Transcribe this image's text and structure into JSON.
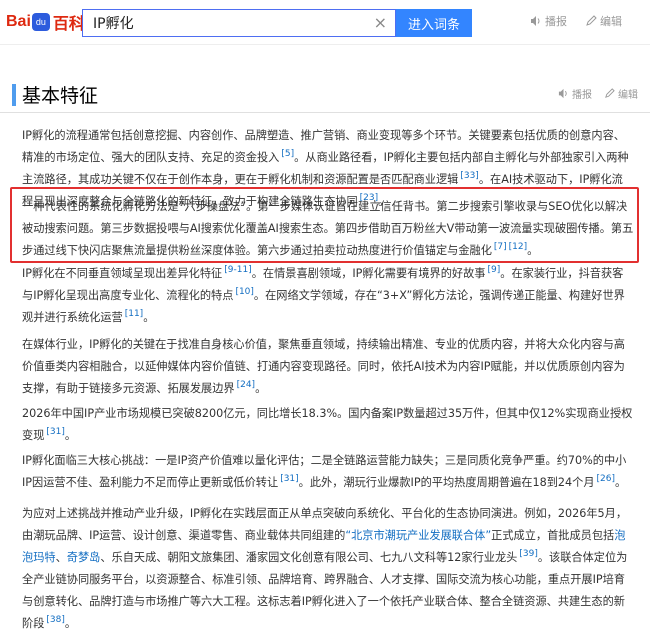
{
  "header": {
    "logo_bai": "Bai",
    "logo_du": "du",
    "logo_baike": "百科",
    "search_value": "IP孵化",
    "search_placeholder": "",
    "clear_icon": "×",
    "enter_button": "进入词条",
    "play_label": "播报",
    "edit_label": "编辑"
  },
  "section": {
    "title": "基本特征",
    "play_label": "播报",
    "edit_label": "编辑"
  },
  "paragraphs": [
    {
      "segments": [
        {
          "t": "IP孵化的流程通常包括创意挖掘、内容创作、品牌塑造、推广营销、商业变现等多个环节。关键要素包括优质的创意内容、精准的市场定位、强大的团队支持、充足的资金投入"
        },
        {
          "r": "[5]"
        },
        {
          "t": "。从商业路径看，IP孵化主要包括内部自主孵化与外部独家引入两种主流路径，其成功关键不仅在于创作本身，更在于孵化机制和资源配置是否匹配商业逻辑"
        },
        {
          "r": "[33]"
        },
        {
          "t": "。在AI技术驱动下，IP孵化流程呈现出深度整合与全链路化的新特征，致力于构建全链路生态协同"
        },
        {
          "r": "[23]"
        },
        {
          "t": "。"
        }
      ]
    },
    {
      "segments": [
        {
          "t": "一种代表性的系统化孵化方法是“六步操盘法”。第一步媒体认证旨在建立信任背书。第二步搜索引擎收录与SEO优化以解决被动搜索问题。第三步数据投喂与AI搜索优化覆盖AI搜索生态。第四步借助百万粉丝大V带动第一波流量实现破圈传播。第五步通过线下快闪店聚焦流量提供粉丝深度体验。第六步通过拍卖拉动热度进行价值锚定与金融化"
        },
        {
          "r": "[7]"
        },
        {
          "r": "[12]"
        },
        {
          "t": "。"
        }
      ]
    },
    {
      "segments": [
        {
          "t": "IP孵化在不同垂直领域呈现出差异化特征"
        },
        {
          "r": "[9-11]"
        },
        {
          "t": "。在情景喜剧领域，IP孵化需要有境界的好故事"
        },
        {
          "r": "[9]"
        },
        {
          "t": "。在家装行业，抖音获客与IP孵化呈现出高度专业化、流程化的特点"
        },
        {
          "r": "[10]"
        },
        {
          "t": "。在网络文学领域，存在“3+X”孵化方法论，强调传递正能量、构建好世界观并进行系统化运营"
        },
        {
          "r": "[11]"
        },
        {
          "t": "。"
        }
      ]
    },
    {
      "segments": [
        {
          "t": "在媒体行业，IP孵化的关键在于找准自身核心价值，聚焦垂直领域，持续输出精准、专业的优质内容，并将大众化内容与高价值垂类内容相融合，以延伸媒体内容价值链、打通内容变现路径。同时，依托AI技术为内容IP赋能，并以优质原创内容为支撑，有助于链接多元资源、拓展发展边界"
        },
        {
          "r": "[24]"
        },
        {
          "t": "。"
        }
      ]
    },
    {
      "segments": [
        {
          "t": "2026年中国IP产业市场规模已突破8200亿元，同比增长18.3%。国内备案IP数量超过35万件，但其中仅12%实现商业授权变现"
        },
        {
          "r": "[31]"
        },
        {
          "t": "。"
        }
      ]
    },
    {
      "segments": [
        {
          "t": "IP孵化面临三大核心挑战：一是IP资产价值难以量化评估；二是全链路运营能力缺失；三是同质化竞争严重。约70%的中小IP因运营不佳、盈利能力不足而停止更新或低价转让"
        },
        {
          "r": "[31]"
        },
        {
          "t": "。此外，潮玩行业爆款IP的平均热度周期普遍在18到24个月"
        },
        {
          "r": "[26]"
        },
        {
          "t": "。"
        }
      ]
    },
    {
      "segments": [
        {
          "t": "为应对上述挑战并推动产业升级，IP孵化在实践层面正从单点突破向系统化、平台化的生态协同演进。例如，2026年5月，由潮玩品牌、IP运营、设计创意、渠道零售、商业载体共同组建的"
        },
        {
          "l": "“北京市潮玩产业发展联合体”"
        },
        {
          "t": "正式成立，首批成员包括"
        },
        {
          "l": "泡泡玛特"
        },
        {
          "t": "、"
        },
        {
          "l": "奇梦岛"
        },
        {
          "t": "、乐自天成、朝阳文旅集团、潘家园文化创意有限公司、七九八文科等12家行业龙头"
        },
        {
          "r": "[39]"
        },
        {
          "t": "。该联合体定位为全产业链协同服务平台，以资源整合、标准引领、品牌培育、跨界融合、人才支撑、国际交流为核心功能，重点开展IP培育与创意转化、品牌打造与市场推广等六大工程。这标志着IP孵化进入了一个依托产业联合体、整合全链资源、共建生态的新阶段"
        },
        {
          "r": "[38]"
        },
        {
          "t": "。"
        }
      ]
    }
  ]
}
